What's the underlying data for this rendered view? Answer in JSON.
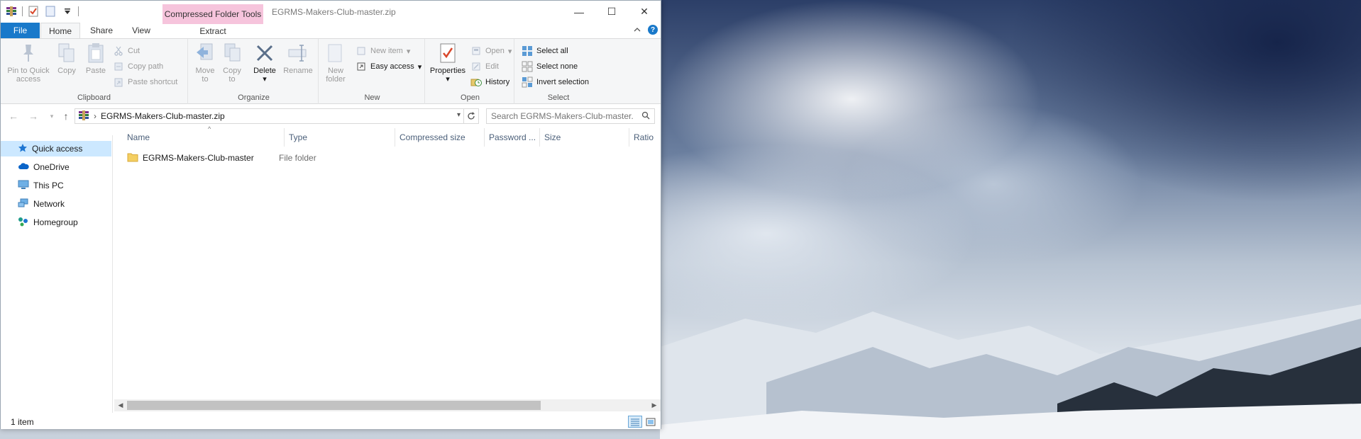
{
  "window": {
    "title": "EGRMS-Makers-Club-master.zip",
    "context_tab_header": "Compressed Folder Tools",
    "controls": {
      "minimize": "—",
      "maximize": "☐",
      "close": "✕"
    }
  },
  "tabs": {
    "file": "File",
    "home": "Home",
    "share": "Share",
    "view": "View",
    "extract": "Extract"
  },
  "ribbon": {
    "clipboard": {
      "label": "Clipboard",
      "pin_to_quick_access_line1": "Pin to Quick",
      "pin_to_quick_access_line2": "access",
      "copy": "Copy",
      "paste": "Paste",
      "cut": "Cut",
      "copy_path": "Copy path",
      "paste_shortcut": "Paste shortcut"
    },
    "organize": {
      "label": "Organize",
      "move_to_line1": "Move",
      "move_to_line2": "to",
      "copy_to_line1": "Copy",
      "copy_to_line2": "to",
      "delete": "Delete",
      "rename": "Rename"
    },
    "new": {
      "label": "New",
      "new_folder_line1": "New",
      "new_folder_line2": "folder",
      "new_item": "New item",
      "easy_access": "Easy access"
    },
    "open": {
      "label": "Open",
      "properties": "Properties",
      "open": "Open",
      "edit": "Edit",
      "history": "History"
    },
    "select": {
      "label": "Select",
      "select_all": "Select all",
      "select_none": "Select none",
      "invert_selection": "Invert selection"
    }
  },
  "address": {
    "path": "EGRMS-Makers-Club-master.zip",
    "search_placeholder": "Search EGRMS-Makers-Club-master...."
  },
  "navpane": {
    "items": [
      {
        "label": "Quick access",
        "icon": "star-icon"
      },
      {
        "label": "OneDrive",
        "icon": "cloud-icon"
      },
      {
        "label": "This PC",
        "icon": "computer-icon"
      },
      {
        "label": "Network",
        "icon": "network-icon"
      },
      {
        "label": "Homegroup",
        "icon": "homegroup-icon"
      }
    ]
  },
  "columns": [
    "Name",
    "Type",
    "Compressed size",
    "Password ...",
    "Size",
    "Ratio"
  ],
  "files": [
    {
      "name": "EGRMS-Makers-Club-master",
      "type": "File folder"
    }
  ],
  "status": {
    "item_count": "1 item"
  },
  "colors": {
    "file_tab": "#1979ca",
    "context_tab": "#f6c4dc",
    "selection": "#cce8ff"
  }
}
